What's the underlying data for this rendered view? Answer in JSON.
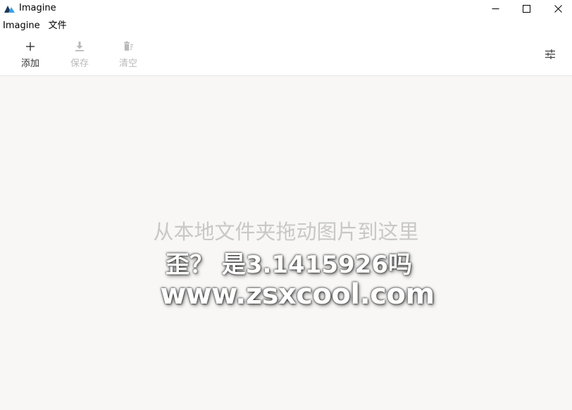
{
  "window": {
    "title": "Imagine",
    "controls": {
      "minimize_icon": "minimize-icon",
      "maximize_icon": "maximize-icon",
      "close_icon": "close-icon"
    }
  },
  "menu": {
    "items": [
      {
        "label": "Imagine"
      },
      {
        "label": "文件"
      }
    ]
  },
  "toolbar": {
    "add_label": "添加",
    "save_label": "保存",
    "clear_label": "清空",
    "add_icon": "plus-icon",
    "save_icon": "download-icon",
    "clear_icon": "trash-icon",
    "settings_icon": "sliders-icon",
    "enabled_color": "#333333",
    "disabled_color": "#b9b9b9"
  },
  "main": {
    "drop_hint": "从本地文件夹拖动图片到这里",
    "background": "#f8f7f6"
  },
  "watermark": {
    "line1": "歪？ 是3.1415926吗",
    "line2": "www.zsxcool.com"
  },
  "colors": {
    "logo_dark": "#1f3b57",
    "logo_light": "#3ea0e4"
  }
}
